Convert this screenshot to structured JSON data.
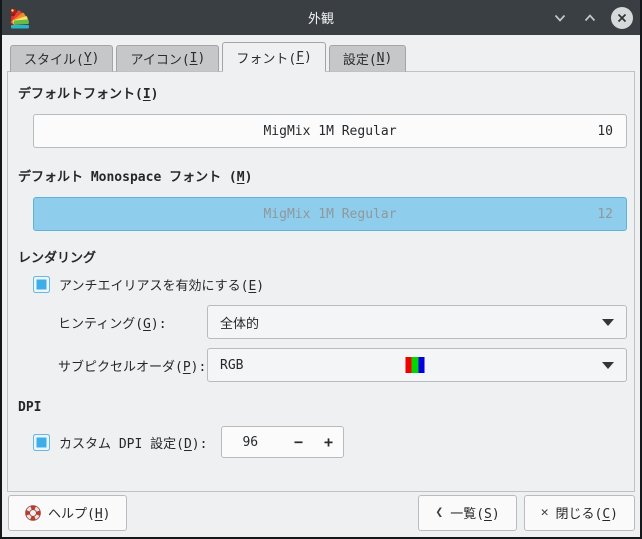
{
  "window": {
    "title": "外観"
  },
  "tabs": [
    {
      "pre": "スタイル(",
      "key": "Y",
      "post": ")"
    },
    {
      "pre": "アイコン(",
      "key": "I",
      "post": ")"
    },
    {
      "pre": "フォント(",
      "key": "F",
      "post": ")"
    },
    {
      "pre": "設定(",
      "key": "N",
      "post": ")"
    }
  ],
  "page": {
    "default_font": {
      "label_pre": "デフォルトフォント(",
      "label_key": "I",
      "label_post": ")",
      "name": "MigMix 1M Regular",
      "size": "10"
    },
    "mono_font": {
      "label_pre": "デフォルト Monospace フォント (",
      "label_key": "M",
      "label_post": ")",
      "name": "MigMix 1M Regular",
      "size": "12"
    },
    "rendering": {
      "heading": "レンダリング",
      "antialias": {
        "pre": "アンチエイリアスを有効にする(",
        "key": "E",
        "post": ")"
      },
      "hinting": {
        "label_pre": "ヒンティング(",
        "label_key": "G",
        "label_post": "):",
        "value": "全体的"
      },
      "subpixel": {
        "label_pre": "サブピクセルオーダ(",
        "label_key": "P",
        "label_post": "):",
        "value": "RGB"
      }
    },
    "dpi": {
      "heading": "DPI",
      "custom": {
        "pre": "カスタム DPI 設定(",
        "key": "D",
        "post": "):"
      },
      "value": "96",
      "decrement": "−",
      "increment": "+"
    }
  },
  "footer": {
    "help": {
      "pre": "ヘルプ(",
      "key": "H",
      "post": ")"
    },
    "overview": {
      "icon": "❮",
      "pre": "一覧(",
      "key": "S",
      "post": ")"
    },
    "close": {
      "icon": "✕",
      "pre": "閉じる(",
      "key": "C",
      "post": ")"
    }
  },
  "colors": {
    "accent": "#3daee9",
    "titlebar": "#3a3f44",
    "selection_fill": "#8ecdeb",
    "rgb_red": "#f20000",
    "rgb_green": "#00d600",
    "rgb_blue": "#0000e0"
  }
}
